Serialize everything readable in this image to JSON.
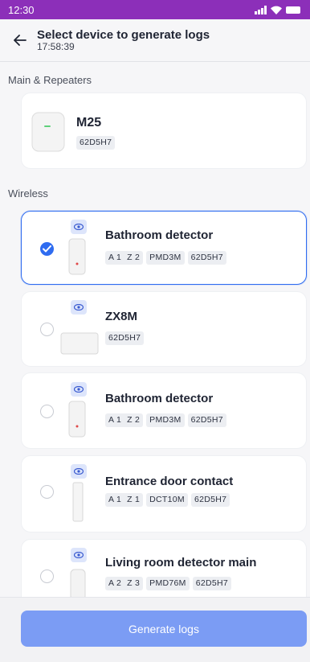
{
  "status": {
    "time": "12:30"
  },
  "header": {
    "title": "Select device to generate logs",
    "subtitle": "17:58:39"
  },
  "sections": {
    "main": "Main & Repeaters",
    "wireless": "Wireless"
  },
  "hub": {
    "name": "M25",
    "id": "62D5H7"
  },
  "devices": [
    {
      "name": "Bathroom detector",
      "selected": true,
      "area": "A 1",
      "zone": "Z 2",
      "model": "PMD3M",
      "id": "62D5H7"
    },
    {
      "name": "ZX8M",
      "selected": false,
      "id": "62D5H7"
    },
    {
      "name": "Bathroom detector",
      "selected": false,
      "area": "A 1",
      "zone": "Z 2",
      "model": "PMD3M",
      "id": "62D5H7"
    },
    {
      "name": "Entrance door contact",
      "selected": false,
      "area": "A 1",
      "zone": "Z 1",
      "model": "DCT10M",
      "id": "62D5H7"
    },
    {
      "name": "Living room detector main",
      "selected": false,
      "area": "A 2",
      "zone": "Z 3",
      "model": "PMD76M",
      "id": "62D5H7"
    }
  ],
  "actions": {
    "generate": "Generate logs"
  },
  "colors": {
    "status_bar": "#8c2fb9",
    "accent": "#2f6cf0",
    "button": "#7b9cf4"
  }
}
